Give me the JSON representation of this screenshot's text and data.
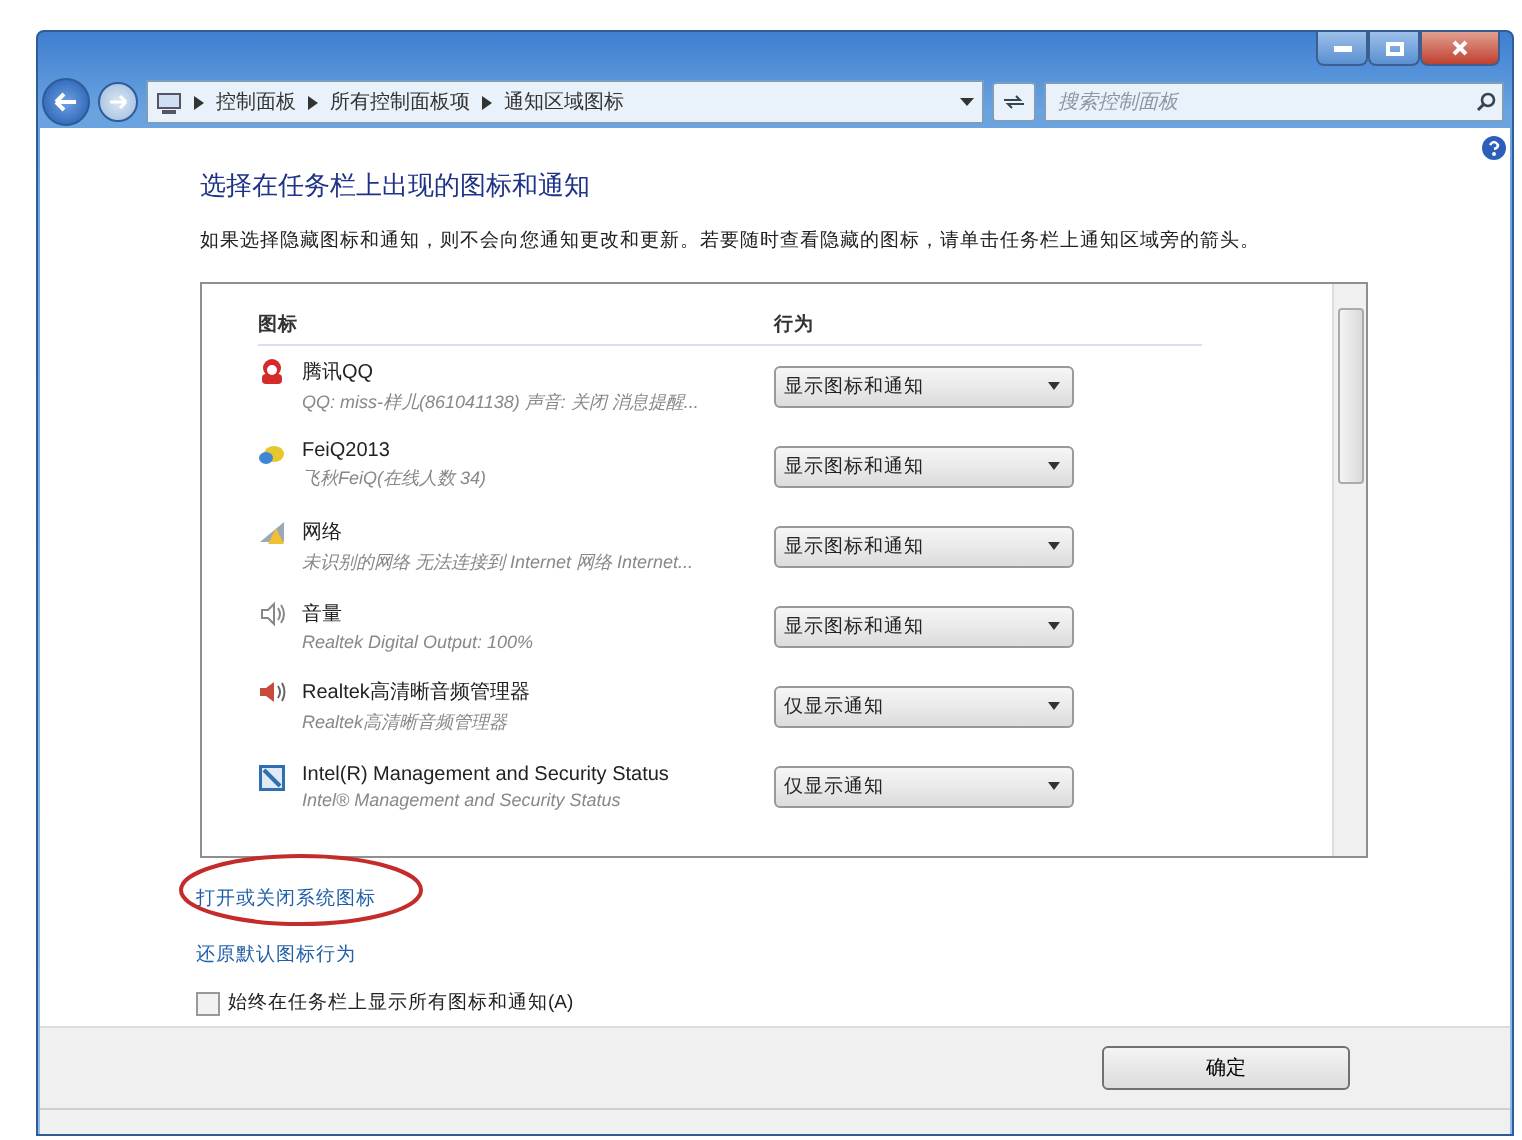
{
  "address_bar": {
    "breadcrumbs": [
      "控制面板",
      "所有控制面板项",
      "通知区域图标"
    ]
  },
  "search": {
    "placeholder": "搜索控制面板"
  },
  "heading": "选择在任务栏上出现的图标和通知",
  "description": "如果选择隐藏图标和通知，则不会向您通知更改和更新。若要随时查看隐藏的图标，请单击任务栏上通知区域旁的箭头。",
  "table": {
    "columns": [
      "图标",
      "行为"
    ],
    "rows": [
      {
        "kind": "chat",
        "name": "腾讯QQ",
        "detail": "QQ: miss-样儿(861041138) 声音: 关闭 消息提醒...",
        "behavior": "显示图标和通知"
      },
      {
        "kind": "bird",
        "name": "FeiQ2013",
        "detail": "飞秋FeiQ(在线人数 34)",
        "behavior": "显示图标和通知"
      },
      {
        "kind": "network",
        "name": "网络",
        "detail": "未识别的网络 无法连接到 Internet 网络 Internet...",
        "behavior": "显示图标和通知"
      },
      {
        "kind": "volume",
        "name": "音量",
        "detail": "Realtek Digital Output: 100%",
        "behavior": "显示图标和通知"
      },
      {
        "kind": "speaker",
        "name": "Realtek高清晰音频管理器",
        "detail": "Realtek高清晰音频管理器",
        "behavior": "仅显示通知"
      },
      {
        "kind": "shield",
        "name": "Intel(R) Management and Security Status",
        "detail": "Intel® Management and Security Status",
        "behavior": "仅显示通知"
      }
    ]
  },
  "links": [
    {
      "label": "打开或关闭系统图标",
      "circled": true
    },
    {
      "label": "还原默认图标行为",
      "circled": false
    }
  ],
  "checkbox": {
    "label": "始终在任务栏上显示所有图标和通知(A)",
    "checked": false
  },
  "buttons": [
    "确定"
  ]
}
